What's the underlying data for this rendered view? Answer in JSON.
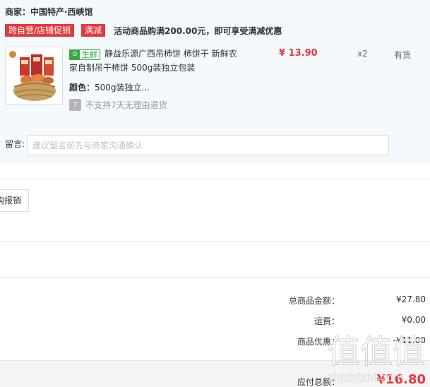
{
  "shop": {
    "merchant": "商家：中国特产·西峡馆",
    "promo_tags": [
      "跨自营/店铺促销",
      "满减"
    ],
    "promo_text": "活动商品购满200.00元，即可享受满减优惠"
  },
  "item": {
    "fresh_badge": "生鲜",
    "title": "静益乐源广西吊柿饼 柿饼干 新鲜农家自制吊干柿饼 500g装独立包装",
    "price": "¥ 13.90",
    "quantity": "x2",
    "stock": "有货",
    "attr_label": "颜色：",
    "attr_value": "500g装独立...",
    "noreturn_icon": "7",
    "noreturn": "不支持7天无理由退货"
  },
  "memo": {
    "label": "留言:",
    "placeholder": "建议留言前先与商家沟通确认"
  },
  "reimburse_button": "购报销",
  "summary": {
    "goods_label": "总商品金额：",
    "goods_value": "¥27.80",
    "shipping_label": "运费：",
    "shipping_value": "¥0.00",
    "discount_label": "商品优惠：",
    "discount_value": "-¥11.00",
    "total_label": "应付总额：",
    "total_value": "¥16.80"
  },
  "watermark": {
    "glyphs": "值值值",
    "text": "zhizhizhi.com"
  },
  "colors": {
    "accent": "#e4393c",
    "shop_bg": "#f3f9fd",
    "fresh_green": "#3aa84a"
  }
}
